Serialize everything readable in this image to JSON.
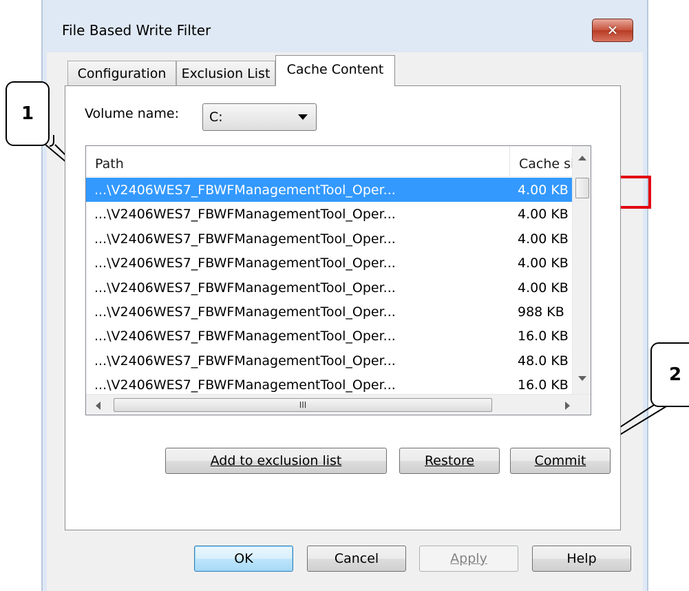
{
  "window": {
    "title": "File Based Write Filter",
    "close_icon": "close-icon"
  },
  "tabs": [
    {
      "label": "Configuration",
      "selected": false
    },
    {
      "label": "Exclusion List",
      "selected": false
    },
    {
      "label": "Cache Content",
      "selected": true
    }
  ],
  "volume": {
    "label": "Volume name:",
    "value": "C:"
  },
  "list": {
    "columns": [
      "Path",
      "Cache size"
    ],
    "rows": [
      {
        "path": "...\\V2406WES7_FBWFManagementTool_Oper...",
        "size": "4.00 KB",
        "selected": true
      },
      {
        "path": "...\\V2406WES7_FBWFManagementTool_Oper...",
        "size": "4.00 KB",
        "selected": false
      },
      {
        "path": "...\\V2406WES7_FBWFManagementTool_Oper...",
        "size": "4.00 KB",
        "selected": false
      },
      {
        "path": "...\\V2406WES7_FBWFManagementTool_Oper...",
        "size": "4.00 KB",
        "selected": false
      },
      {
        "path": "...\\V2406WES7_FBWFManagementTool_Oper...",
        "size": "4.00 KB",
        "selected": false
      },
      {
        "path": "...\\V2406WES7_FBWFManagementTool_Oper...",
        "size": "988 KB",
        "selected": false
      },
      {
        "path": "...\\V2406WES7_FBWFManagementTool_Oper...",
        "size": "16.0 KB",
        "selected": false
      },
      {
        "path": "...\\V2406WES7_FBWFManagementTool_Oper...",
        "size": "48.0 KB",
        "selected": false
      },
      {
        "path": "...\\V2406WES7_FBWFManagementTool_Oper...",
        "size": "16.0 KB",
        "selected": false
      }
    ],
    "hscroll_grip": "III"
  },
  "actions": {
    "add_exclusion": "Add to exclusion list",
    "restore": "Restore",
    "commit": "Commit"
  },
  "footer": {
    "ok": "OK",
    "cancel": "Cancel",
    "apply": "Apply",
    "help": "Help"
  },
  "annotations": {
    "callout_1": "1",
    "callout_2": "2",
    "highlight_color": "#e3000f"
  }
}
